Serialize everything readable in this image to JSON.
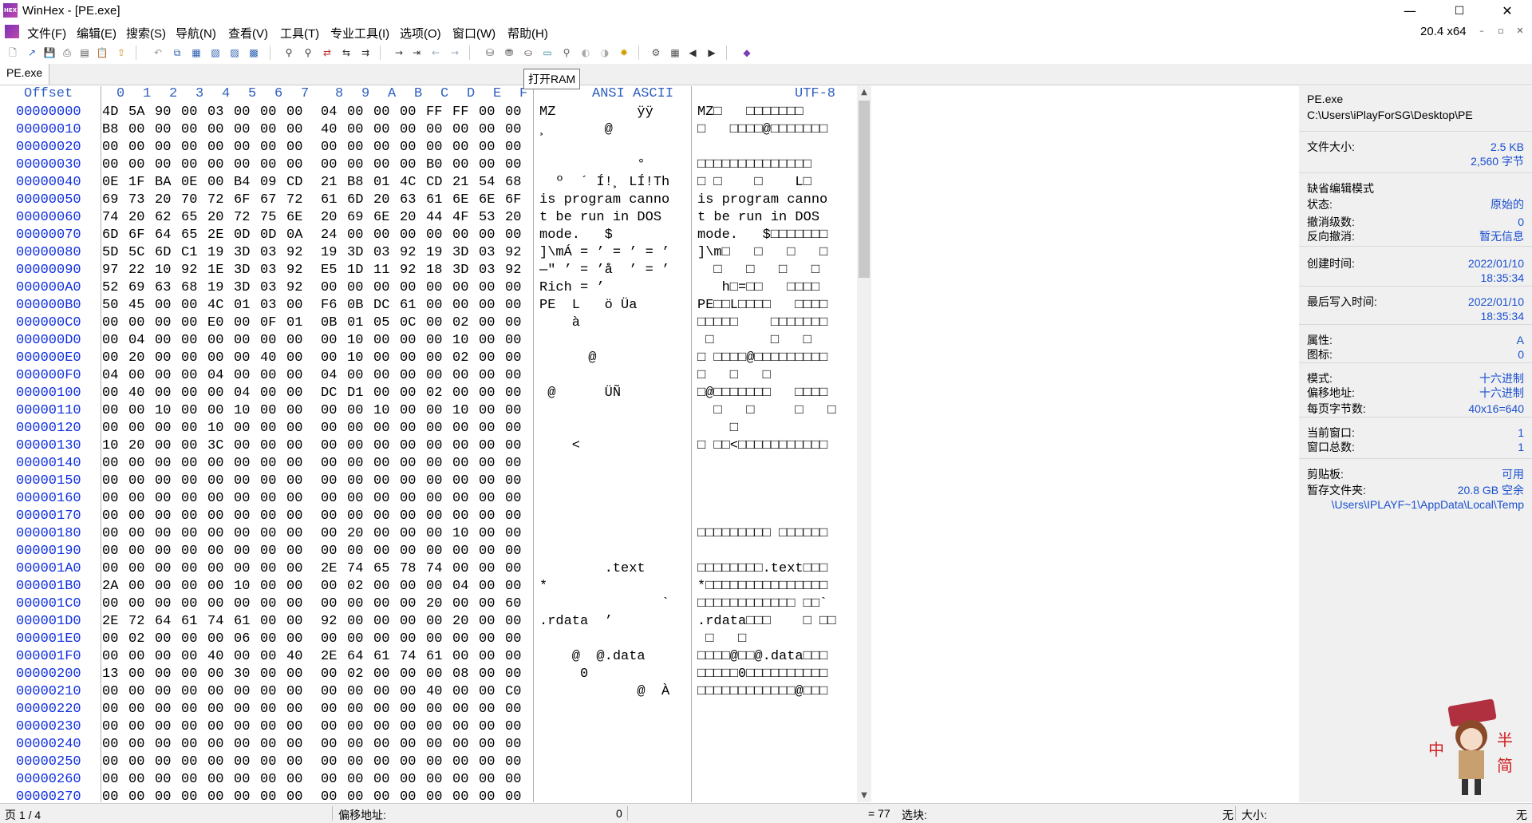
{
  "window": {
    "title": "WinHex - [PE.exe]",
    "icon_text": "HEX",
    "min": "—",
    "max": "☐",
    "close": "✕"
  },
  "menu": {
    "items": [
      "文件(F)",
      "编辑(E)",
      "搜索(S)",
      "导航(N)",
      "查看(V)",
      "工具(T)",
      "专业工具(I)",
      "选项(O)",
      "窗口(W)",
      "帮助(H)"
    ],
    "arch": "20.4 x64",
    "mdi": [
      "–",
      "▫",
      "✕"
    ]
  },
  "toolbar": {
    "tooltip": "打开RAM"
  },
  "tab": {
    "label": "PE.exe"
  },
  "hex": {
    "offset_label": "Offset",
    "col_labels": [
      "0",
      "1",
      "2",
      "3",
      "4",
      "5",
      "6",
      "7",
      "8",
      "9",
      "A",
      "B",
      "C",
      "D",
      "E",
      "F"
    ],
    "ansi_label": "ANSI ASCII",
    "utf_label": "UTF-8",
    "rows": [
      {
        "off": "00000000",
        "b": [
          "4D",
          "5A",
          "90",
          "00",
          "03",
          "00",
          "00",
          "00",
          "04",
          "00",
          "00",
          "00",
          "FF",
          "FF",
          "00",
          "00"
        ],
        "a": "MZ          ÿÿ",
        "u": "MZ□   □□□□□□□"
      },
      {
        "off": "00000010",
        "b": [
          "B8",
          "00",
          "00",
          "00",
          "00",
          "00",
          "00",
          "00",
          "40",
          "00",
          "00",
          "00",
          "00",
          "00",
          "00",
          "00"
        ],
        "a": "¸       @",
        "u": "□   □□□□@□□□□□□□"
      },
      {
        "off": "00000020",
        "b": [
          "00",
          "00",
          "00",
          "00",
          "00",
          "00",
          "00",
          "00",
          "00",
          "00",
          "00",
          "00",
          "00",
          "00",
          "00",
          "00"
        ],
        "a": "",
        "u": ""
      },
      {
        "off": "00000030",
        "b": [
          "00",
          "00",
          "00",
          "00",
          "00",
          "00",
          "00",
          "00",
          "00",
          "00",
          "00",
          "00",
          "B0",
          "00",
          "00",
          "00"
        ],
        "a": "            °",
        "u": "□□□□□□□□□□□□□□"
      },
      {
        "off": "00000040",
        "b": [
          "0E",
          "1F",
          "BA",
          "0E",
          "00",
          "B4",
          "09",
          "CD",
          "21",
          "B8",
          "01",
          "4C",
          "CD",
          "21",
          "54",
          "68"
        ],
        "a": "  º  ´ Í!¸ LÍ!Th",
        "u": "□ □    □    L□"
      },
      {
        "off": "00000050",
        "b": [
          "69",
          "73",
          "20",
          "70",
          "72",
          "6F",
          "67",
          "72",
          "61",
          "6D",
          "20",
          "63",
          "61",
          "6E",
          "6E",
          "6F"
        ],
        "a": "is program canno",
        "u": "is program canno"
      },
      {
        "off": "00000060",
        "b": [
          "74",
          "20",
          "62",
          "65",
          "20",
          "72",
          "75",
          "6E",
          "20",
          "69",
          "6E",
          "20",
          "44",
          "4F",
          "53",
          "20"
        ],
        "a": "t be run in DOS ",
        "u": "t be run in DOS "
      },
      {
        "off": "00000070",
        "b": [
          "6D",
          "6F",
          "64",
          "65",
          "2E",
          "0D",
          "0D",
          "0A",
          "24",
          "00",
          "00",
          "00",
          "00",
          "00",
          "00",
          "00"
        ],
        "a": "mode.   $",
        "u": "mode.   $□□□□□□□"
      },
      {
        "off": "00000080",
        "b": [
          "5D",
          "5C",
          "6D",
          "C1",
          "19",
          "3D",
          "03",
          "92",
          "19",
          "3D",
          "03",
          "92",
          "19",
          "3D",
          "03",
          "92"
        ],
        "a": "]\\mÁ = ’ = ’ = ’",
        "u": "]\\m□   □   □   □"
      },
      {
        "off": "00000090",
        "b": [
          "97",
          "22",
          "10",
          "92",
          "1E",
          "3D",
          "03",
          "92",
          "E5",
          "1D",
          "11",
          "92",
          "18",
          "3D",
          "03",
          "92"
        ],
        "a": "—\" ’ = ’å  ’ = ’",
        "u": "  □   □   □   □"
      },
      {
        "off": "000000A0",
        "b": [
          "52",
          "69",
          "63",
          "68",
          "19",
          "3D",
          "03",
          "92",
          "00",
          "00",
          "00",
          "00",
          "00",
          "00",
          "00",
          "00"
        ],
        "a": "Rich = ’",
        "u": "   h□=□□   □□□□"
      },
      {
        "off": "000000B0",
        "b": [
          "50",
          "45",
          "00",
          "00",
          "4C",
          "01",
          "03",
          "00",
          "F6",
          "0B",
          "DC",
          "61",
          "00",
          "00",
          "00",
          "00"
        ],
        "a": "PE  L   ö Üa",
        "u": "PE□□L□□□□   □□□□"
      },
      {
        "off": "000000C0",
        "b": [
          "00",
          "00",
          "00",
          "00",
          "E0",
          "00",
          "0F",
          "01",
          "0B",
          "01",
          "05",
          "0C",
          "00",
          "02",
          "00",
          "00"
        ],
        "a": "    à",
        "u": "□□□□□    □□□□□□□"
      },
      {
        "off": "000000D0",
        "b": [
          "00",
          "04",
          "00",
          "00",
          "00",
          "00",
          "00",
          "00",
          "00",
          "10",
          "00",
          "00",
          "00",
          "10",
          "00",
          "00"
        ],
        "a": "",
        "u": " □       □   □"
      },
      {
        "off": "000000E0",
        "b": [
          "00",
          "20",
          "00",
          "00",
          "00",
          "00",
          "40",
          "00",
          "00",
          "10",
          "00",
          "00",
          "00",
          "02",
          "00",
          "00"
        ],
        "a": "      @",
        "u": "□ □□□□@□□□□□□□□□"
      },
      {
        "off": "000000F0",
        "b": [
          "04",
          "00",
          "00",
          "00",
          "04",
          "00",
          "00",
          "00",
          "04",
          "00",
          "00",
          "00",
          "00",
          "00",
          "00",
          "00"
        ],
        "a": "",
        "u": "□   □   □"
      },
      {
        "off": "00000100",
        "b": [
          "00",
          "40",
          "00",
          "00",
          "00",
          "04",
          "00",
          "00",
          "DC",
          "D1",
          "00",
          "00",
          "02",
          "00",
          "00",
          "00"
        ],
        "a": " @      ÜÑ",
        "u": "□@□□□□□□□   □□□□"
      },
      {
        "off": "00000110",
        "b": [
          "00",
          "00",
          "10",
          "00",
          "00",
          "10",
          "00",
          "00",
          "00",
          "00",
          "10",
          "00",
          "00",
          "10",
          "00",
          "00"
        ],
        "a": "",
        "u": "  □   □     □   □"
      },
      {
        "off": "00000120",
        "b": [
          "00",
          "00",
          "00",
          "00",
          "10",
          "00",
          "00",
          "00",
          "00",
          "00",
          "00",
          "00",
          "00",
          "00",
          "00",
          "00"
        ],
        "a": "",
        "u": "    □"
      },
      {
        "off": "00000130",
        "b": [
          "10",
          "20",
          "00",
          "00",
          "3C",
          "00",
          "00",
          "00",
          "00",
          "00",
          "00",
          "00",
          "00",
          "00",
          "00",
          "00"
        ],
        "a": "    <",
        "u": "□ □□<□□□□□□□□□□□"
      },
      {
        "off": "00000140",
        "b": [
          "00",
          "00",
          "00",
          "00",
          "00",
          "00",
          "00",
          "00",
          "00",
          "00",
          "00",
          "00",
          "00",
          "00",
          "00",
          "00"
        ],
        "a": "",
        "u": ""
      },
      {
        "off": "00000150",
        "b": [
          "00",
          "00",
          "00",
          "00",
          "00",
          "00",
          "00",
          "00",
          "00",
          "00",
          "00",
          "00",
          "00",
          "00",
          "00",
          "00"
        ],
        "a": "",
        "u": ""
      },
      {
        "off": "00000160",
        "b": [
          "00",
          "00",
          "00",
          "00",
          "00",
          "00",
          "00",
          "00",
          "00",
          "00",
          "00",
          "00",
          "00",
          "00",
          "00",
          "00"
        ],
        "a": "",
        "u": ""
      },
      {
        "off": "00000170",
        "b": [
          "00",
          "00",
          "00",
          "00",
          "00",
          "00",
          "00",
          "00",
          "00",
          "00",
          "00",
          "00",
          "00",
          "00",
          "00",
          "00"
        ],
        "a": "",
        "u": ""
      },
      {
        "off": "00000180",
        "b": [
          "00",
          "00",
          "00",
          "00",
          "00",
          "00",
          "00",
          "00",
          "00",
          "20",
          "00",
          "00",
          "00",
          "10",
          "00",
          "00"
        ],
        "a": "",
        "u": "□□□□□□□□□ □□□□□□"
      },
      {
        "off": "00000190",
        "b": [
          "00",
          "00",
          "00",
          "00",
          "00",
          "00",
          "00",
          "00",
          "00",
          "00",
          "00",
          "00",
          "00",
          "00",
          "00",
          "00"
        ],
        "a": "",
        "u": ""
      },
      {
        "off": "000001A0",
        "b": [
          "00",
          "00",
          "00",
          "00",
          "00",
          "00",
          "00",
          "00",
          "2E",
          "74",
          "65",
          "78",
          "74",
          "00",
          "00",
          "00"
        ],
        "a": "        .text",
        "u": "□□□□□□□□.text□□□"
      },
      {
        "off": "000001B0",
        "b": [
          "2A",
          "00",
          "00",
          "00",
          "00",
          "10",
          "00",
          "00",
          "00",
          "02",
          "00",
          "00",
          "00",
          "04",
          "00",
          "00"
        ],
        "a": "*",
        "u": "*□□□□□□□□□□□□□□□"
      },
      {
        "off": "000001C0",
        "b": [
          "00",
          "00",
          "00",
          "00",
          "00",
          "00",
          "00",
          "00",
          "00",
          "00",
          "00",
          "00",
          "20",
          "00",
          "00",
          "60"
        ],
        "a": "               `",
        "u": "□□□□□□□□□□□□ □□`"
      },
      {
        "off": "000001D0",
        "b": [
          "2E",
          "72",
          "64",
          "61",
          "74",
          "61",
          "00",
          "00",
          "92",
          "00",
          "00",
          "00",
          "00",
          "20",
          "00",
          "00"
        ],
        "a": ".rdata  ’",
        "u": ".rdata□□□    □ □□"
      },
      {
        "off": "000001E0",
        "b": [
          "00",
          "02",
          "00",
          "00",
          "00",
          "06",
          "00",
          "00",
          "00",
          "00",
          "00",
          "00",
          "00",
          "00",
          "00",
          "00"
        ],
        "a": "",
        "u": " □   □"
      },
      {
        "off": "000001F0",
        "b": [
          "00",
          "00",
          "00",
          "00",
          "40",
          "00",
          "00",
          "40",
          "2E",
          "64",
          "61",
          "74",
          "61",
          "00",
          "00",
          "00"
        ],
        "a": "    @  @.data",
        "u": "□□□□@□□@.data□□□"
      },
      {
        "off": "00000200",
        "b": [
          "13",
          "00",
          "00",
          "00",
          "00",
          "30",
          "00",
          "00",
          "00",
          "02",
          "00",
          "00",
          "00",
          "08",
          "00",
          "00"
        ],
        "a": "     0",
        "u": "□□□□□0□□□□□□□□□□"
      },
      {
        "off": "00000210",
        "b": [
          "00",
          "00",
          "00",
          "00",
          "00",
          "00",
          "00",
          "00",
          "00",
          "00",
          "00",
          "00",
          "40",
          "00",
          "00",
          "C0"
        ],
        "a": "            @  À",
        "u": "□□□□□□□□□□□□@□□□"
      },
      {
        "off": "00000220",
        "b": [
          "00",
          "00",
          "00",
          "00",
          "00",
          "00",
          "00",
          "00",
          "00",
          "00",
          "00",
          "00",
          "00",
          "00",
          "00",
          "00"
        ],
        "a": "",
        "u": ""
      },
      {
        "off": "00000230",
        "b": [
          "00",
          "00",
          "00",
          "00",
          "00",
          "00",
          "00",
          "00",
          "00",
          "00",
          "00",
          "00",
          "00",
          "00",
          "00",
          "00"
        ],
        "a": "",
        "u": ""
      },
      {
        "off": "00000240",
        "b": [
          "00",
          "00",
          "00",
          "00",
          "00",
          "00",
          "00",
          "00",
          "00",
          "00",
          "00",
          "00",
          "00",
          "00",
          "00",
          "00"
        ],
        "a": "",
        "u": ""
      },
      {
        "off": "00000250",
        "b": [
          "00",
          "00",
          "00",
          "00",
          "00",
          "00",
          "00",
          "00",
          "00",
          "00",
          "00",
          "00",
          "00",
          "00",
          "00",
          "00"
        ],
        "a": "",
        "u": ""
      },
      {
        "off": "00000260",
        "b": [
          "00",
          "00",
          "00",
          "00",
          "00",
          "00",
          "00",
          "00",
          "00",
          "00",
          "00",
          "00",
          "00",
          "00",
          "00",
          "00"
        ],
        "a": "",
        "u": ""
      },
      {
        "off": "00000270",
        "b": [
          "00",
          "00",
          "00",
          "00",
          "00",
          "00",
          "00",
          "00",
          "00",
          "00",
          "00",
          "00",
          "00",
          "00",
          "00",
          "00"
        ],
        "a": "",
        "u": ""
      }
    ]
  },
  "side": {
    "file_name": "PE.exe",
    "file_path": "C:\\Users\\iPlayForSG\\Desktop\\PE",
    "rows": [
      {
        "l": "文件大小:",
        "r": "2.5 KB"
      },
      {
        "l": "",
        "r": "2,560 字节"
      },
      {
        "l": "缺省编辑模式",
        "r": ""
      },
      {
        "l": "状态:",
        "r": "原始的"
      },
      {
        "l": "撤消级数:",
        "r": "0"
      },
      {
        "l": "反向撤消:",
        "r": "暂无信息"
      },
      {
        "l": "创建时间:",
        "r": "2022/01/10"
      },
      {
        "l": "",
        "r": "18:35:34"
      },
      {
        "l": "最后写入时间:",
        "r": "2022/01/10"
      },
      {
        "l": "",
        "r": "18:35:34"
      },
      {
        "l": "属性:",
        "r": "A"
      },
      {
        "l": "图标:",
        "r": "0"
      },
      {
        "l": "模式:",
        "r": "十六进制"
      },
      {
        "l": "偏移地址:",
        "r": "十六进制"
      },
      {
        "l": "每页字节数:",
        "r": "40x16=640"
      },
      {
        "l": "当前窗口:",
        "r": "1"
      },
      {
        "l": "窗口总数:",
        "r": "1"
      },
      {
        "l": "剪贴板:",
        "r": "可用"
      },
      {
        "l": "暂存文件夹:",
        "r": "20.8 GB 空余"
      },
      {
        "l": "",
        "r": "\\Users\\IPLAYF~1\\AppData\\Local\\Temp"
      }
    ]
  },
  "status": {
    "page": "页 1 / 4",
    "offset_label": "偏移地址:",
    "offset_value": "0",
    "eq": "= 77",
    "selection_label": "选块:",
    "selection_value": "无",
    "size_label": "大小:",
    "size_value": "无"
  },
  "colors": {
    "offset": "#1030e0",
    "header": "#3060c0",
    "side_value": "#1a4fd0"
  }
}
